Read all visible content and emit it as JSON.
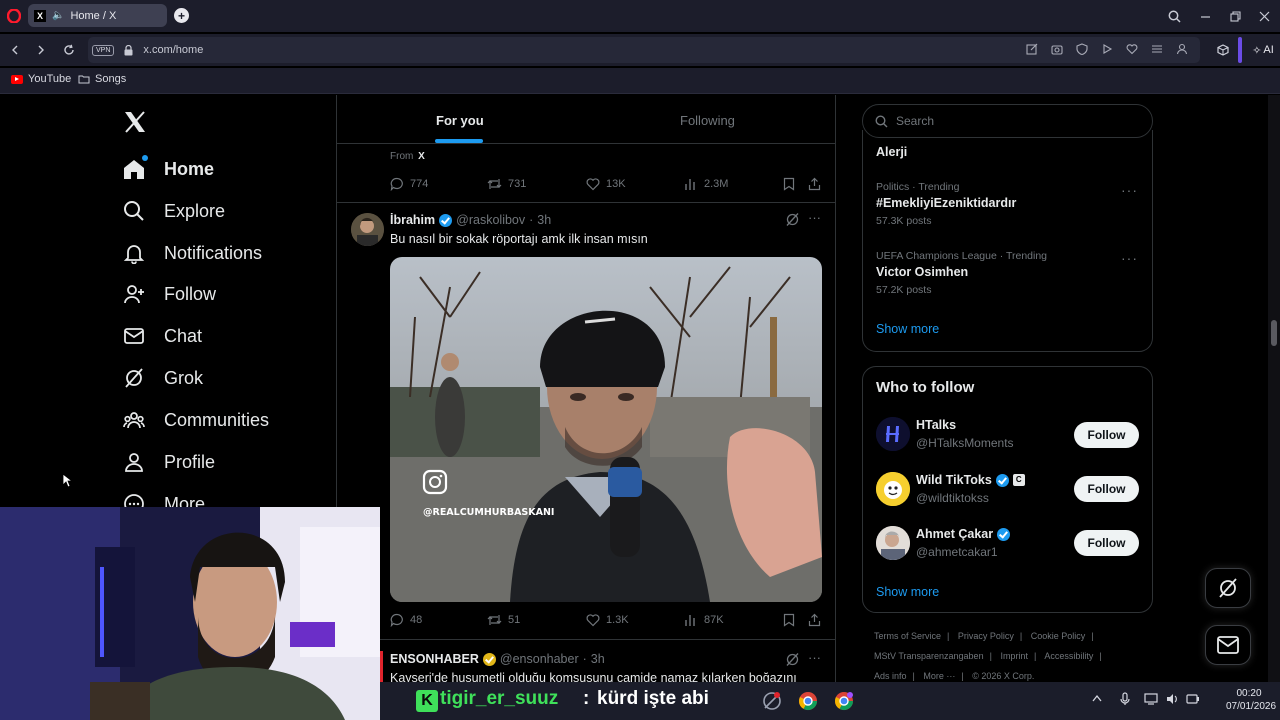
{
  "browser": {
    "tab_title": "Home / X",
    "url": "x.com/home",
    "vpn_label": "VPN",
    "ai_label": "AI",
    "bookmarks": [
      "YouTube",
      "Songs"
    ]
  },
  "sidebar": {
    "items": [
      {
        "label": "Home",
        "icon": "home-icon"
      },
      {
        "label": "Explore",
        "icon": "search-icon"
      },
      {
        "label": "Notifications",
        "icon": "bell-icon"
      },
      {
        "label": "Follow",
        "icon": "follow-user-icon"
      },
      {
        "label": "Chat",
        "icon": "mail-icon"
      },
      {
        "label": "Grok",
        "icon": "grok-icon"
      },
      {
        "label": "Communities",
        "icon": "communities-icon"
      },
      {
        "label": "Profile",
        "icon": "profile-icon"
      },
      {
        "label": "More",
        "icon": "more-icon"
      }
    ]
  },
  "feed": {
    "tabs": [
      "For you",
      "Following"
    ],
    "active_tab": "For you",
    "prev_post": {
      "source_prefix": "From",
      "source_name": "X",
      "replies": "774",
      "reposts": "731",
      "likes": "13K",
      "views": "2.3M"
    },
    "post": {
      "name": "İbrahim",
      "handle": "@raskolibov",
      "time": "3h",
      "text": "Bu nasıl bir sokak röportajı amk ilk insan mısın",
      "media_watermark": "@REALCUMHURBASKANI",
      "replies": "48",
      "reposts": "51",
      "likes": "1.3K",
      "views": "87K"
    },
    "next_post": {
      "name": "ENSONHABER",
      "handle": "@ensonhaber",
      "time": "3h",
      "text": "Kayseri'de husumetli olduğu komşusunu camide namaz kılarken boğazını"
    }
  },
  "right": {
    "search_placeholder": "Search",
    "trends": [
      {
        "meta": "",
        "name": "Alerji",
        "count": ""
      },
      {
        "meta": "Politics · Trending",
        "name": "#EmekliyiEzeniktidardır",
        "count": "57.3K posts"
      },
      {
        "meta": "UEFA Champions League · Trending",
        "name": "Victor Osimhen",
        "count": "57.2K posts"
      }
    ],
    "trends_show_more": "Show more",
    "who_to_follow_title": "Who to follow",
    "suggestions": [
      {
        "name": "HTalks",
        "handle": "@HTalksMoments",
        "button": "Follow"
      },
      {
        "name": "Wild TikToks",
        "handle": "@wildtiktokss",
        "button": "Follow",
        "badge": "C"
      },
      {
        "name": "Ahmet Çakar",
        "handle": "@ahmetcakar1",
        "button": "Follow"
      }
    ],
    "follow_show_more": "Show more",
    "footer_row1": [
      "Terms of Service",
      "Privacy Policy",
      "Cookie Policy"
    ],
    "footer_row2": [
      "MStV Transparenzangaben",
      "Imprint",
      "Accessibility"
    ],
    "footer_row3": [
      "Ads info",
      "More ···",
      "© 2026 X Corp."
    ]
  },
  "overlay": {
    "chat_user": "tigir_er_suuz",
    "chat_message": "kürd işte abi"
  },
  "taskbar": {
    "time": "00:20",
    "date": "07/01/2026"
  },
  "colors": {
    "accent": "#1d9bf0",
    "background": "#000000",
    "border": "#2f3336",
    "chat_user": "#3fe05a"
  }
}
